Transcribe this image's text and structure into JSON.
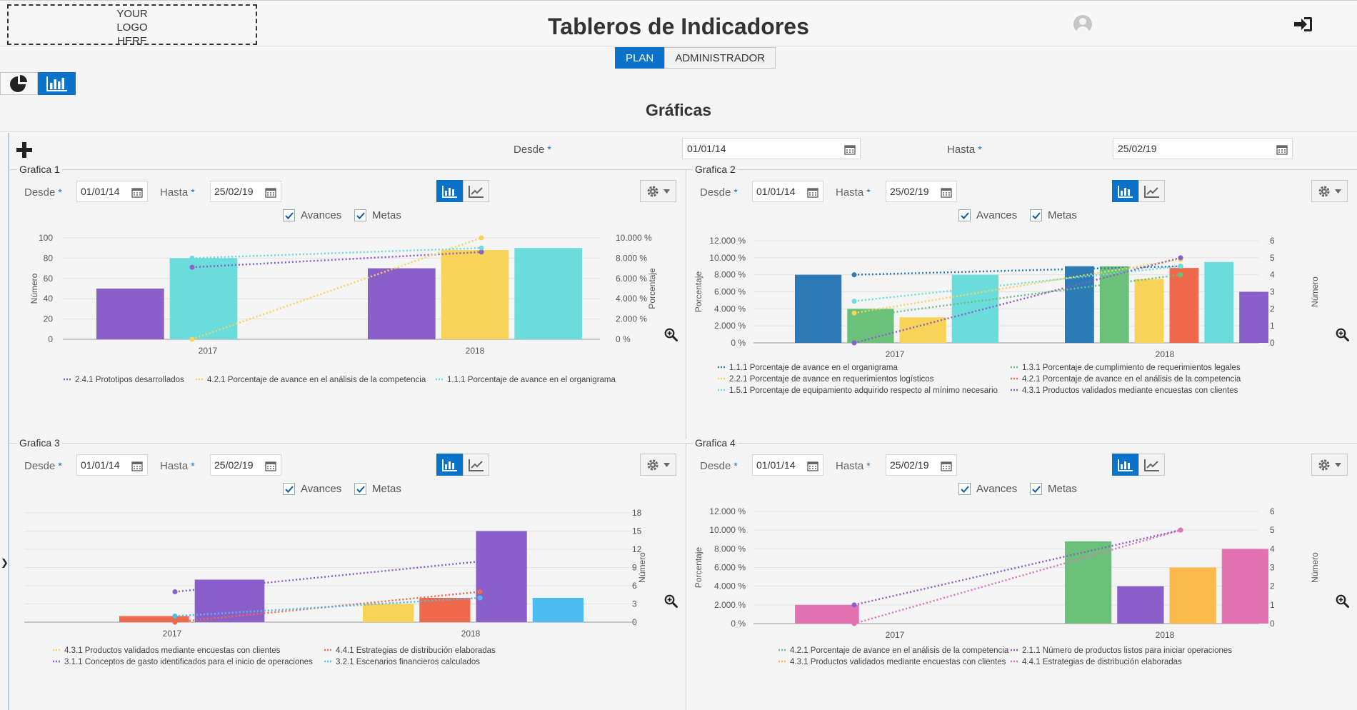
{
  "header": {
    "logo_text": "YOUR\nLOGO\nHERE",
    "title": "Tableros de Indicadores"
  },
  "nav": {
    "tabs": [
      "PLAN",
      "ADMINISTRADOR"
    ],
    "active": "PLAN"
  },
  "page": {
    "section_title": "Gráficas",
    "filter": {
      "desde_label": "Desde",
      "desde_value": "01/01/14",
      "hasta_label": "Hasta",
      "hasta_value": "25/02/19"
    }
  },
  "panels": [
    {
      "title": "Grafica 1",
      "desde_label": "Desde",
      "desde_value": "01/01/14",
      "hasta_label": "Hasta",
      "hasta_value": "25/02/19",
      "chk_avances": "Avances",
      "chk_metas": "Metas"
    },
    {
      "title": "Grafica 2",
      "desde_label": "Desde",
      "desde_value": "01/01/14",
      "hasta_label": "Hasta",
      "hasta_value": "25/02/19",
      "chk_avances": "Avances",
      "chk_metas": "Metas"
    },
    {
      "title": "Grafica 3",
      "desde_label": "Desde",
      "desde_value": "01/01/14",
      "hasta_label": "Hasta",
      "hasta_value": "25/02/19",
      "chk_avances": "Avances",
      "chk_metas": "Metas"
    },
    {
      "title": "Grafica 4",
      "desde_label": "Desde",
      "desde_value": "01/01/14",
      "hasta_label": "Hasta",
      "hasta_value": "25/02/19",
      "chk_avances": "Avances",
      "chk_metas": "Metas"
    }
  ],
  "colors": {
    "purple": "#8a5fca",
    "yellow": "#f7d358",
    "teal": "#6adcdc",
    "blue": "#2c7bb6",
    "green": "#6cc17a",
    "red": "#ef6a4c",
    "orange": "#fbb84d",
    "pink": "#e272b4",
    "lightblue": "#4cbbef",
    "accent": "#0a72c9"
  },
  "chart_data": [
    {
      "type": "bar",
      "categories": [
        "2017",
        "2018"
      ],
      "yleft": {
        "label": "Número",
        "ticks": [
          "0",
          "20",
          "40",
          "60",
          "80",
          "100"
        ],
        "max": 100
      },
      "yright": {
        "label": "Porcentaje",
        "ticks": [
          "0 %",
          "2.000 %",
          "4.000 %",
          "6.000 %",
          "8.000 %",
          "10.000 %"
        ],
        "max": 10000
      },
      "series": [
        {
          "name": "2.4.1 Prototipos desarrollados",
          "color": "purple",
          "axis": "left",
          "values": [
            50,
            70
          ],
          "target": [
            71,
            86
          ]
        },
        {
          "name": "4.2.1 Porcentaje de avance en el análisis de la competencia",
          "color": "yellow",
          "axis": "right",
          "values": [
            null,
            8800
          ],
          "target": [
            0,
            10000
          ]
        },
        {
          "name": "1.1.1 Porcentaje de avance en el organigrama",
          "color": "teal",
          "axis": "right",
          "values": [
            8000,
            9000
          ],
          "target": [
            8000,
            9000
          ]
        }
      ]
    },
    {
      "type": "bar",
      "categories": [
        "2017",
        "2018"
      ],
      "yleft": {
        "label": "Porcentaje",
        "ticks": [
          "0 %",
          "2.000 %",
          "4.000 %",
          "6.000 %",
          "8.000 %",
          "10.000 %",
          "12.000 %"
        ],
        "max": 12000
      },
      "yright": {
        "label": "Número",
        "ticks": [
          "0",
          "1",
          "2",
          "3",
          "4",
          "5",
          "6"
        ],
        "max": 6
      },
      "series": [
        {
          "name": "1.1.1 Porcentaje de avance en el organigrama",
          "color": "blue",
          "axis": "left",
          "values": [
            8000,
            9000
          ],
          "target": [
            8000,
            9000
          ]
        },
        {
          "name": "1.3.1 Porcentaje de cumplimiento de requerimientos legales",
          "color": "green",
          "axis": "left",
          "values": [
            4000,
            9000
          ],
          "target": [
            3000,
            8000
          ]
        },
        {
          "name": "2.2.1 Porcentaje de avance en requerimientos logísticos",
          "color": "yellow",
          "axis": "left",
          "values": [
            3000,
            7500
          ],
          "target": [
            3500,
            9800
          ]
        },
        {
          "name": "4.2.1 Porcentaje de avance en el análisis de la competencia",
          "color": "red",
          "axis": "left",
          "values": [
            null,
            8800
          ],
          "target": [
            null,
            null
          ]
        },
        {
          "name": "1.5.1 Porcentaje de equipamiento adquirido respecto al mínimo necesario",
          "color": "teal",
          "axis": "left",
          "values": [
            8000,
            9500
          ],
          "target": [
            4900,
            9000
          ]
        },
        {
          "name": "4.3.1 Productos validados mediante encuestas con clientes",
          "color": "purple",
          "axis": "right",
          "values": [
            null,
            3
          ],
          "target": [
            0,
            5
          ]
        }
      ]
    },
    {
      "type": "bar",
      "categories": [
        "2017",
        "2018"
      ],
      "yleft": {
        "label": "",
        "ticks": [],
        "max": 18
      },
      "yright": {
        "label": "Número",
        "ticks": [
          "0",
          "3",
          "6",
          "9",
          "12",
          "15",
          "18"
        ],
        "max": 18
      },
      "series": [
        {
          "name": "4.3.1 Productos validados mediante encuestas con clientes",
          "color": "yellow",
          "axis": "right",
          "values": [
            null,
            3
          ],
          "target": [
            null,
            null
          ]
        },
        {
          "name": "4.4.1 Estrategias de distribución elaboradas",
          "color": "red",
          "axis": "right",
          "values": [
            1,
            4
          ],
          "target": [
            0,
            5
          ]
        },
        {
          "name": "3.1.1 Conceptos de gasto identificados para el inicio de operaciones",
          "color": "purple",
          "axis": "right",
          "values": [
            7,
            15
          ],
          "target": [
            5,
            10
          ]
        },
        {
          "name": "3.2.1 Escenarios financieros calculados",
          "color": "lightblue",
          "axis": "right",
          "values": [
            null,
            4
          ],
          "target": [
            1,
            4
          ]
        }
      ]
    },
    {
      "type": "bar",
      "categories": [
        "2017",
        "2018"
      ],
      "yleft": {
        "label": "Porcentaje",
        "ticks": [
          "0 %",
          "2.000 %",
          "4.000 %",
          "6.000 %",
          "8.000 %",
          "10.000 %",
          "12.000 %"
        ],
        "max": 12000
      },
      "yright": {
        "label": "Número",
        "ticks": [
          "0",
          "1",
          "2",
          "3",
          "4",
          "5",
          "6"
        ],
        "max": 6
      },
      "series": [
        {
          "name": "4.2.1 Porcentaje de avance en el análisis de la competencia",
          "color": "green",
          "axis": "left",
          "values": [
            null,
            8800
          ],
          "target": [
            null,
            null
          ]
        },
        {
          "name": "2.1.1 Número de productos listos para iniciar operaciones",
          "color": "purple",
          "axis": "right",
          "values": [
            null,
            2
          ],
          "target": [
            1,
            5
          ]
        },
        {
          "name": "4.3.1 Productos validados mediante encuestas con clientes",
          "color": "orange",
          "axis": "right",
          "values": [
            null,
            3
          ],
          "target": [
            null,
            null
          ]
        },
        {
          "name": "4.4.1 Estrategias de distribución elaboradas",
          "color": "pink",
          "axis": "right",
          "values": [
            1,
            4
          ],
          "target": [
            0,
            5
          ]
        }
      ]
    }
  ]
}
